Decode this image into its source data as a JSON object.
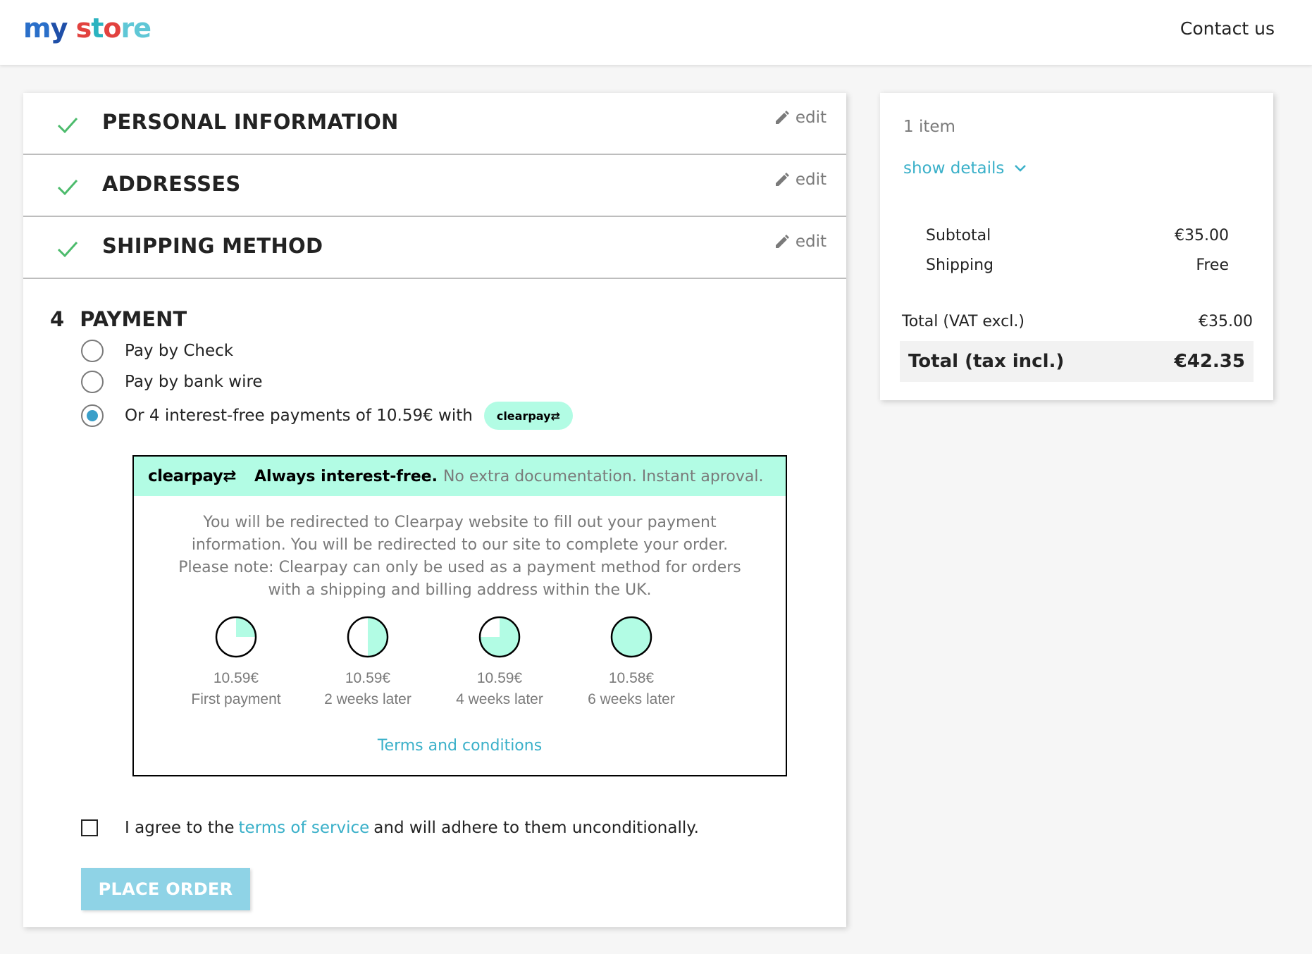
{
  "header": {
    "logo_parts": [
      "m",
      "y",
      " s",
      "t",
      "o",
      "re"
    ],
    "contact": "Contact us"
  },
  "steps": [
    {
      "title": "PERSONAL INFORMATION",
      "edit": "edit"
    },
    {
      "title": "ADDRESSES",
      "edit": "edit"
    },
    {
      "title": "SHIPPING METHOD",
      "edit": "edit"
    }
  ],
  "payment": {
    "number": "4",
    "title": "PAYMENT",
    "options": [
      {
        "label": "Pay by Check",
        "selected": false
      },
      {
        "label": "Pay by bank wire",
        "selected": false
      },
      {
        "label": "Or 4 interest-free payments of 10.59€ with",
        "selected": true,
        "badge": "clearpay"
      }
    ],
    "clearpay": {
      "logo": "clearpay",
      "headline": "Always interest-free.",
      "subline": "No extra documentation. Instant aproval.",
      "info": "You will be redirected to Clearpay website to fill out your payment information. You will be redirected to our site to complete your order. Please note: Clearpay can only be used as a payment method for orders with a shipping and billing address within the UK.",
      "installments": [
        {
          "amount": "10.59€",
          "when": "First payment",
          "fill": 0.25
        },
        {
          "amount": "10.59€",
          "when": "2 weeks later",
          "fill": 0.5
        },
        {
          "amount": "10.59€",
          "when": "4 weeks later",
          "fill": 0.75
        },
        {
          "amount": "10.58€",
          "when": "6 weeks later",
          "fill": 1.0
        }
      ],
      "terms": "Terms and conditions",
      "accent": "#b2fce4"
    },
    "agree": {
      "before": "I agree to the",
      "link": "terms of service",
      "after": "and will adhere to them unconditionally.",
      "checked": false
    },
    "place_order": "PLACE ORDER"
  },
  "summary": {
    "items": "1 item",
    "show_details": "show details",
    "subtotal_label": "Subtotal",
    "subtotal_value": "€35.00",
    "shipping_label": "Shipping",
    "shipping_value": "Free",
    "total_excl_label": "Total (VAT excl.)",
    "total_excl_value": "€35.00",
    "total_incl_label": "Total (tax incl.)",
    "total_incl_value": "€42.35"
  },
  "colors": {
    "link": "#3ab0c9",
    "check": "#4cbb6c",
    "button": "#8fd3e6"
  }
}
